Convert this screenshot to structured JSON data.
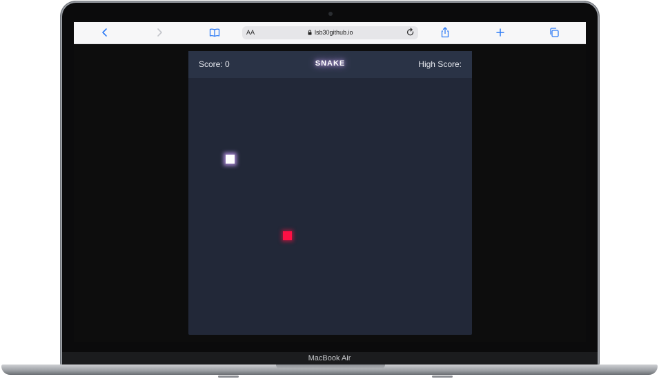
{
  "browser": {
    "text_size_label": "AA",
    "url": "lsb30github.io",
    "icons": [
      "back-icon",
      "forward-icon",
      "bookmarks-icon",
      "lock-icon",
      "reload-icon",
      "share-icon",
      "new-tab-icon",
      "tabs-icon"
    ]
  },
  "game": {
    "score_label": "Score: 0",
    "title": "SNAKE",
    "high_score_label": "High Score:",
    "colors": {
      "background": "#222838",
      "header": "#2a3346",
      "snake": "#ffffff",
      "snake_glow": "#cda0ff",
      "food": "#ff1044"
    }
  },
  "device": {
    "brand_label": "MacBook Air"
  }
}
